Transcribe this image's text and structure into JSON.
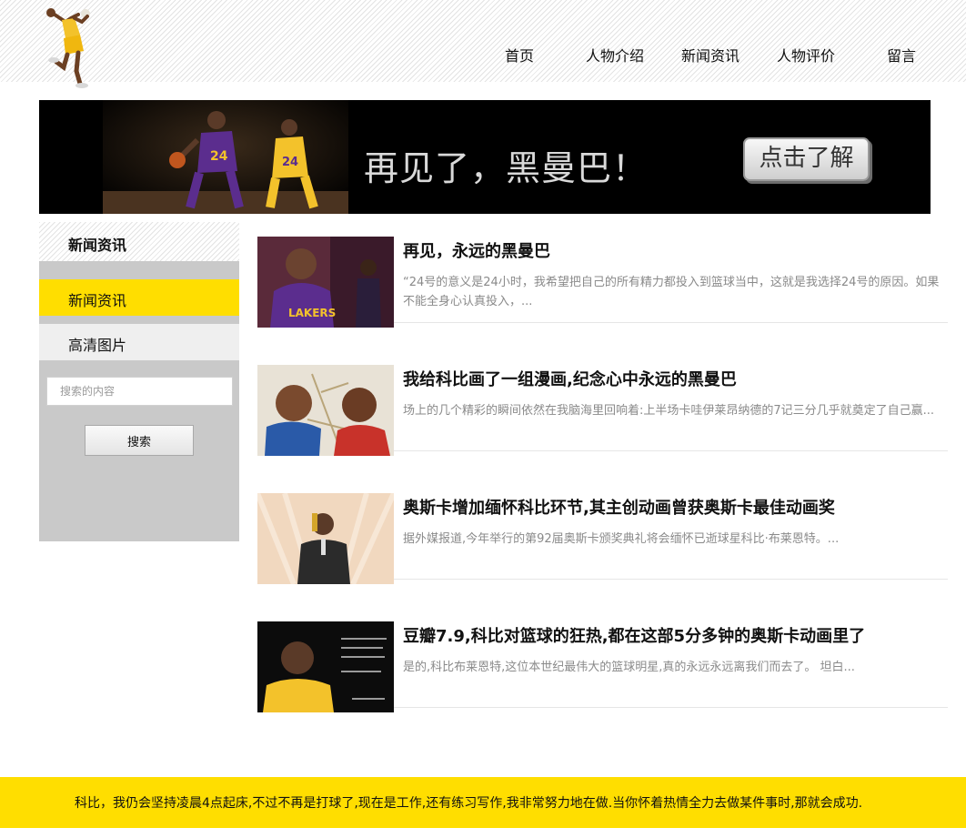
{
  "nav": {
    "items": [
      {
        "label": "首页"
      },
      {
        "label": "人物介绍"
      },
      {
        "label": "新闻资讯"
      },
      {
        "label": "人物评价"
      },
      {
        "label": "留言"
      }
    ]
  },
  "banner": {
    "text": "再见了，黑曼巴！",
    "button_label": "点击了解"
  },
  "sidebar": {
    "title": "新闻资讯",
    "items": [
      {
        "label": "新闻资讯",
        "active": true
      },
      {
        "label": "高清图片",
        "active": false
      }
    ],
    "search": {
      "placeholder": "搜索的内容",
      "value": "",
      "button_label": "搜索"
    }
  },
  "articles": [
    {
      "title": "再见，永远的黑曼巴",
      "summary": "“24号的意义是24小时，我希望把自己的所有精力都投入到篮球当中，这就是我选择24号的原因。如果不能全身心认真投入，..."
    },
    {
      "title": "我给科比画了一组漫画,纪念心中永远的黑曼巴",
      "summary": "场上的几个精彩的瞬间依然在我脑海里回响着:上半场卡哇伊莱昂纳德的7记三分几乎就奠定了自己赢..."
    },
    {
      "title": "奥斯卡增加缅怀科比环节,其主创动画曾获奥斯卡最佳动画奖",
      "summary": "据外媒报道,今年举行的第92届奥斯卡颁奖典礼将会缅怀已逝球星科比·布莱恩特。..."
    },
    {
      "title": "豆瓣7.9,科比对篮球的狂热,都在这部5分多钟的奥斯卡动画里了",
      "summary": "是的,科比布莱恩特,这位本世纪最伟大的篮球明星,真的永远永远离我们而去了。 坦白..."
    }
  ],
  "footer": {
    "text": "科比，我仍会坚持凌晨4点起床,不过不再是打球了,现在是工作,还有练习写作,我非常努力地在做.当你怀着热情全力去做某件事时,那就会成功."
  },
  "colors": {
    "accent_yellow": "#ffde00",
    "sidebar_gray": "#c9c9c9",
    "banner_black": "#000000"
  }
}
